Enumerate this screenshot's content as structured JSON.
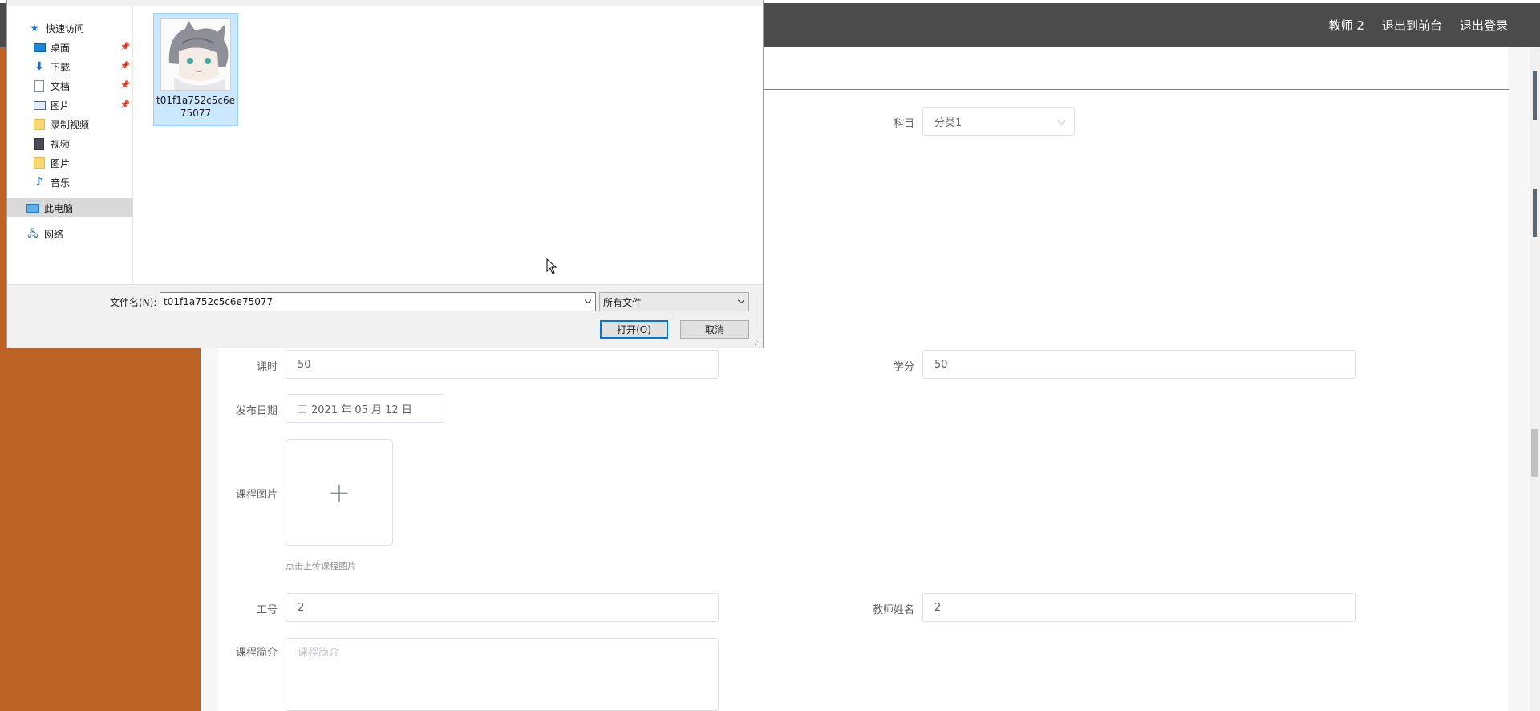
{
  "header": {
    "links": [
      "教师 2",
      "退出到前台",
      "退出登录"
    ]
  },
  "form": {
    "subject_label": "科目",
    "subject_value": "分类1",
    "hours_label": "课时",
    "hours_value": "50",
    "credit_label": "学分",
    "credit_value": "50",
    "date_label": "发布日期",
    "date_value": "2021 年 05 月 12 日",
    "image_label": "课程图片",
    "upload_plus": "+",
    "upload_hint": "点击上传课程图片",
    "staff_id_label": "工号",
    "staff_id_value": "2",
    "teacher_name_label": "教师姓名",
    "teacher_name_value": "2",
    "intro_label": "课程简介",
    "intro_placeholder": "课程简介"
  },
  "dialog": {
    "nav": [
      {
        "label": "快速访问",
        "icon": "star-icon",
        "pinned": false
      },
      {
        "label": "桌面",
        "icon": "desktop-icon",
        "pinned": true
      },
      {
        "label": "下载",
        "icon": "download-icon",
        "pinned": true
      },
      {
        "label": "文档",
        "icon": "document-icon",
        "pinned": true
      },
      {
        "label": "图片",
        "icon": "pictures-icon",
        "pinned": true
      },
      {
        "label": "录制视频",
        "icon": "folder-icon",
        "pinned": false
      },
      {
        "label": "视频",
        "icon": "video-icon",
        "pinned": false
      },
      {
        "label": "图片",
        "icon": "folder-icon",
        "pinned": false
      },
      {
        "label": "音乐",
        "icon": "music-icon",
        "pinned": false
      },
      {
        "label": "此电脑",
        "icon": "computer-icon",
        "pinned": false,
        "selected": true
      },
      {
        "label": "网络",
        "icon": "network-icon",
        "pinned": false
      }
    ],
    "file": {
      "name": "t01f1a752c5c6e75077"
    },
    "filename_label": "文件名(N):",
    "filename_value": "t01f1a752c5c6e75077",
    "filetype_value": "所有文件",
    "open_button": "打开(O)",
    "cancel_button": "取消"
  }
}
